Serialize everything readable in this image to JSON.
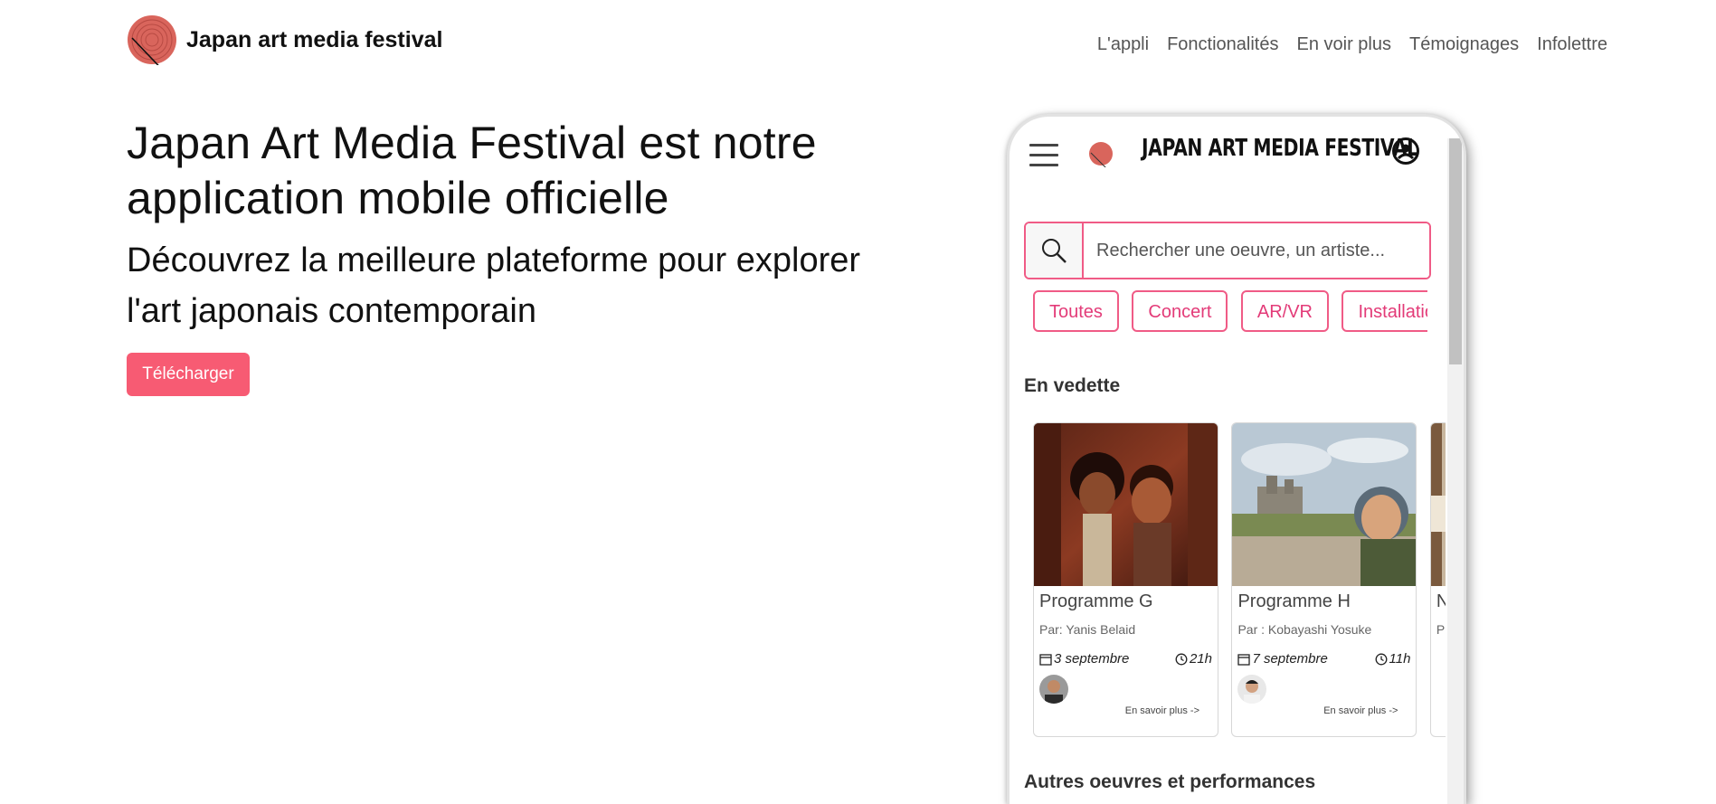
{
  "brand": {
    "name": "Japan art media festival",
    "logo_icon": "concentric-circle-logo-icon"
  },
  "nav": {
    "items": [
      "L'appli",
      "Fonctionalités",
      "En voir plus",
      "Témoignages",
      "Infolettre"
    ]
  },
  "hero": {
    "title": "Japan Art Media Festival est notre application mobile officielle",
    "subtitle": "Découvrez la meilleure plateforme pour explorer l'art japonais contemporain",
    "cta_label": "Télécharger"
  },
  "app": {
    "title": "JAPAN ART MEDIA FESTIVAL",
    "search": {
      "placeholder": "Rechercher une oeuvre, un artiste..."
    },
    "chips": [
      "Toutes",
      "Concert",
      "AR/VR",
      "Installation"
    ],
    "featured_title": "En vedette",
    "other_title": "Autres oeuvres et performances",
    "cards": [
      {
        "title": "Programme G",
        "by": "Par: Yanis Belaid",
        "date": "3 septembre",
        "time": "21h",
        "more": "En savoir plus ->"
      },
      {
        "title": "Programme H",
        "by": "Par : Kobayashi Yosuke",
        "date": "7 septembre",
        "time": "11h",
        "more": "En savoir plus ->"
      },
      {
        "title": "N",
        "by": "P",
        "date": "",
        "time": "",
        "more": ""
      }
    ]
  },
  "colors": {
    "accent": "#f75b73",
    "chip_border": "#f05b86",
    "chip_text": "#e33b78",
    "logo": "#d9655c"
  }
}
